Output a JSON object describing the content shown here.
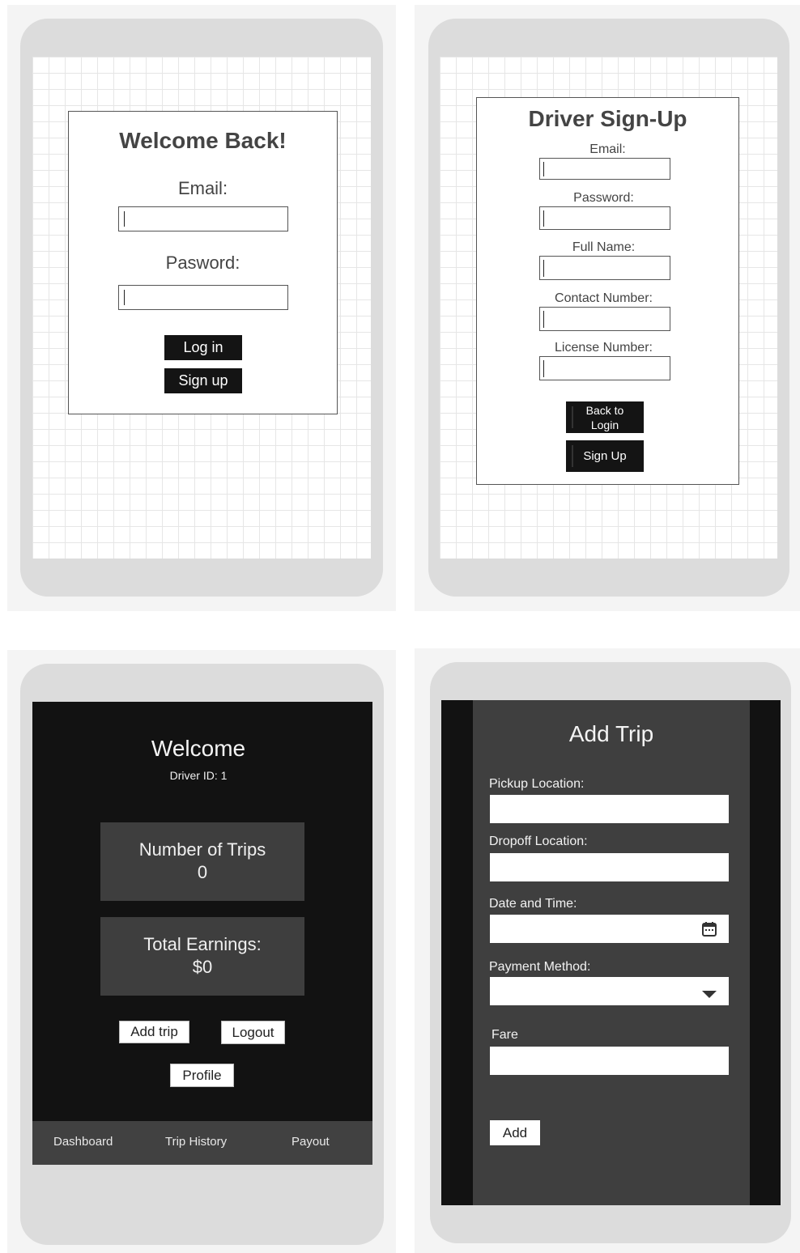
{
  "login": {
    "title": "Welcome Back!",
    "email_label": "Email:",
    "password_label": "Pasword:",
    "login_button": "Log in",
    "signup_button": "Sign up"
  },
  "signup": {
    "title": "Driver Sign-Up",
    "fields": [
      {
        "label": "Email:"
      },
      {
        "label": "Password:"
      },
      {
        "label": "Full Name:"
      },
      {
        "label": "Contact Number:"
      },
      {
        "label": "License Number:"
      }
    ],
    "back_button_line1": "Back to",
    "back_button_line2": "Login",
    "signup_button": "Sign Up"
  },
  "dashboard": {
    "title": "Welcome",
    "driver_id": "Driver ID: 1",
    "trips_label": "Number of Trips",
    "trips_value": "0",
    "earnings_label": "Total Earnings:",
    "earnings_value": "$0",
    "add_trip_button": "Add trip",
    "logout_button": "Logout",
    "profile_button": "Profile",
    "nav": [
      "Dashboard",
      "Trip History",
      "Payout"
    ]
  },
  "add_trip": {
    "title": "Add Trip",
    "pickup_label": "Pickup Location:",
    "dropoff_label": "Dropoff Location:",
    "datetime_label": "Date and Time:",
    "payment_label": "Payment Method:",
    "fare_label": "Fare",
    "add_button": "Add"
  },
  "icons": [
    "calendar-icon",
    "chevron-down-icon"
  ],
  "colors": {
    "dark_bg": "#121212",
    "dark_panel": "#3f3f3f",
    "phone_frame": "#dcdcdc",
    "button_black": "#141414"
  }
}
